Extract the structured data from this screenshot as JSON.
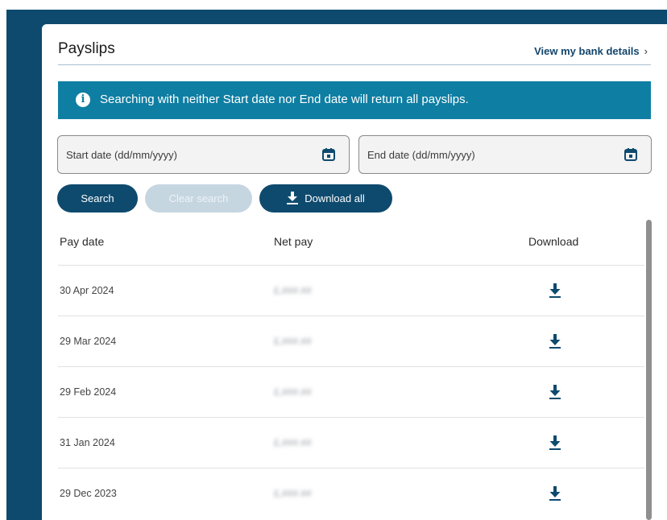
{
  "header": {
    "title": "Payslips",
    "bank_link": "View my bank details",
    "bank_link_chevron": "›"
  },
  "banner": {
    "icon": "info-icon",
    "text": "Searching with neither Start date nor End date will return all payslips."
  },
  "filters": {
    "start_placeholder": "Start date (dd/mm/yyyy)",
    "end_placeholder": "End date (dd/mm/yyyy)",
    "start_value": "",
    "end_value": "",
    "calendar_icon": "calendar-icon"
  },
  "buttons": {
    "search": "Search",
    "clear": "Clear search",
    "download_all": "Download all"
  },
  "table": {
    "columns": [
      "Pay date",
      "Net pay",
      "Download"
    ],
    "rows": [
      {
        "date": "30 Apr 2024",
        "net": "£,###.##"
      },
      {
        "date": "29 Mar 2024",
        "net": "£,###.##"
      },
      {
        "date": "29 Feb 2024",
        "net": "£,###.##"
      },
      {
        "date": "31 Jan 2024",
        "net": "£,###.##"
      },
      {
        "date": "29 Dec 2023",
        "net": "£,###.##"
      }
    ]
  },
  "colors": {
    "brand": "#0e4a6e",
    "banner": "#0f7ea3",
    "disabled_button": "#c6d6e1"
  }
}
